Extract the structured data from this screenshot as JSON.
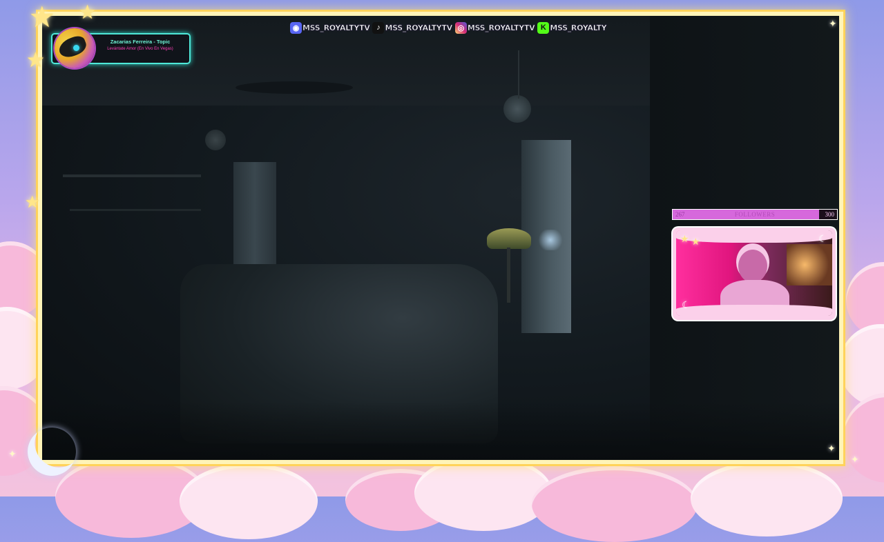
{
  "now_playing": {
    "title": "Zacarias Ferreira - Topic",
    "subtitle": "Levántate Amor (En Vivo En Vegas)"
  },
  "socials": [
    {
      "platform": "discord",
      "icon": "discord-icon",
      "handle": "MSS_ROYALTYTV",
      "color": "#5865f2"
    },
    {
      "platform": "tiktok",
      "icon": "tiktok-icon",
      "handle": "MSS_ROYALTYTV",
      "color": "#111111"
    },
    {
      "platform": "instagram",
      "icon": "instagram-icon",
      "handle": "MSS_ROYALTYTV",
      "color": "#d6249f"
    },
    {
      "platform": "kick",
      "icon": "kick-icon",
      "handle": "MSS_ROYALTY",
      "color": "#53fc18"
    }
  ],
  "followers_goal": {
    "label": "FOLLOWERS",
    "current": "267",
    "goal": "300",
    "progress": 0.89
  },
  "colors": {
    "frame_border": "#fff4b8",
    "frame_glow": "#ffd35a",
    "cloud_pink": "#f7b9da",
    "now_playing_accent": "#4fe8d8",
    "followers_bar": "#d668dc"
  }
}
